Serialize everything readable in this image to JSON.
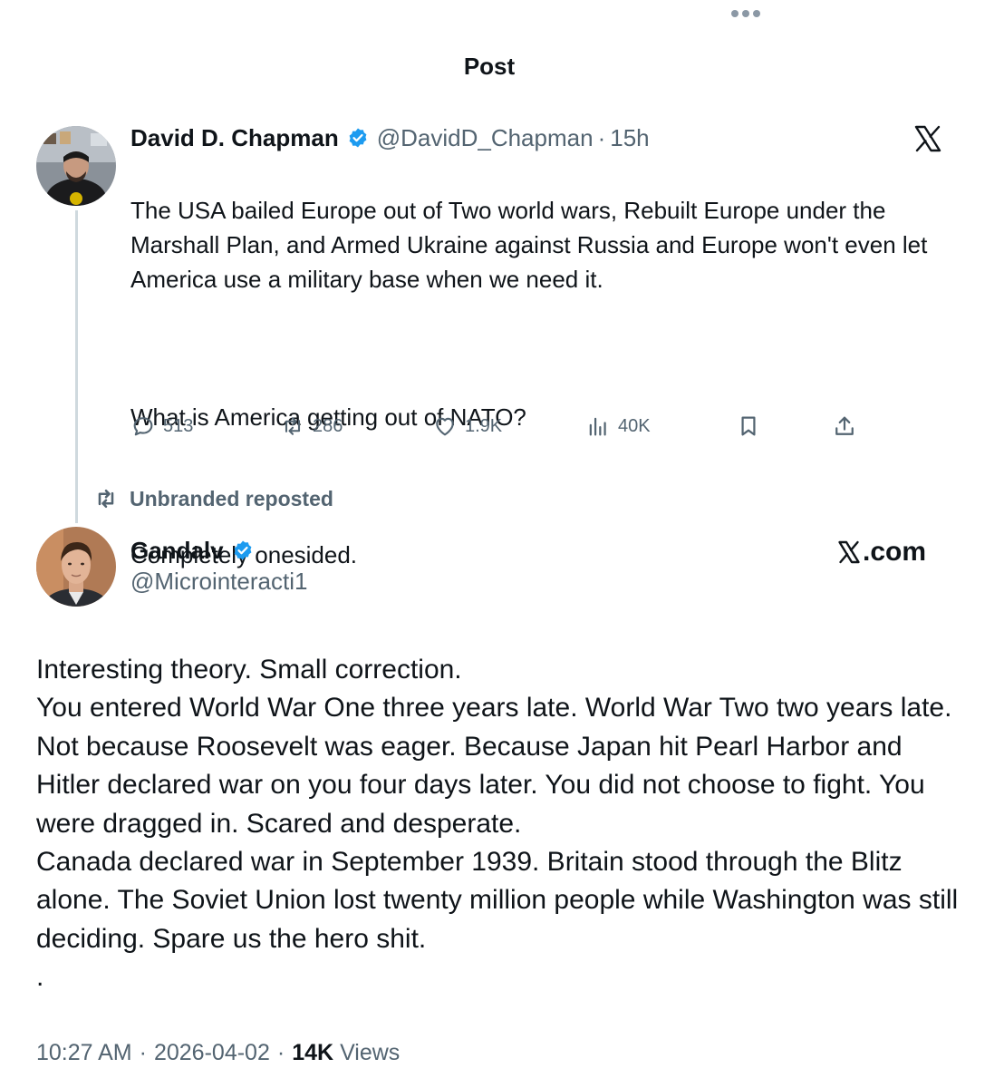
{
  "header": {
    "title": "Post",
    "more_icon": "more-horizontal-icon"
  },
  "quoted_post": {
    "author_name": "David D. Chapman",
    "handle": "@DavidD_Chapman",
    "separator": "·",
    "time": "15h",
    "verified": true,
    "paragraphs": [
      "The USA bailed Europe out of Two world wars, Rebuilt Europe under the Marshall Plan, and Armed Ukraine against Russia and Europe won't even let America use a military base when we need it.",
      "What is America getting out of NATO?",
      "Completely onesided."
    ],
    "actions": {
      "replies": "513",
      "reposts": "286",
      "likes": "1.9K",
      "views": "40K"
    },
    "platform_icon": "x-logo-icon"
  },
  "repost_label": "Unbranded reposted",
  "main_post": {
    "author_name": "Gandalv",
    "handle": "@Microinteracti1",
    "verified": true,
    "source_label": ".com",
    "lines": [
      "Interesting theory. Small correction.",
      "You entered World War One three years late. World War Two two years late. Not because Roosevelt was eager. Because Japan hit Pearl Harbor and Hitler declared war on you four days later. You did not choose to fight. You were dragged in. Scared and desperate.",
      "Canada declared war in September 1939. Britain stood through the Blitz alone. The Soviet Union lost twenty million people while Washington was still deciding. Spare us the hero shit.",
      "."
    ],
    "meta": {
      "time": "10:27 AM",
      "separator": "·",
      "date": "2026-04-02",
      "views_count": "14K",
      "views_label": "Views"
    }
  },
  "colors": {
    "text_primary": "#0f1419",
    "text_secondary": "#536471",
    "verified_blue": "#1d9bf0",
    "thread_line": "#cfd9de"
  }
}
